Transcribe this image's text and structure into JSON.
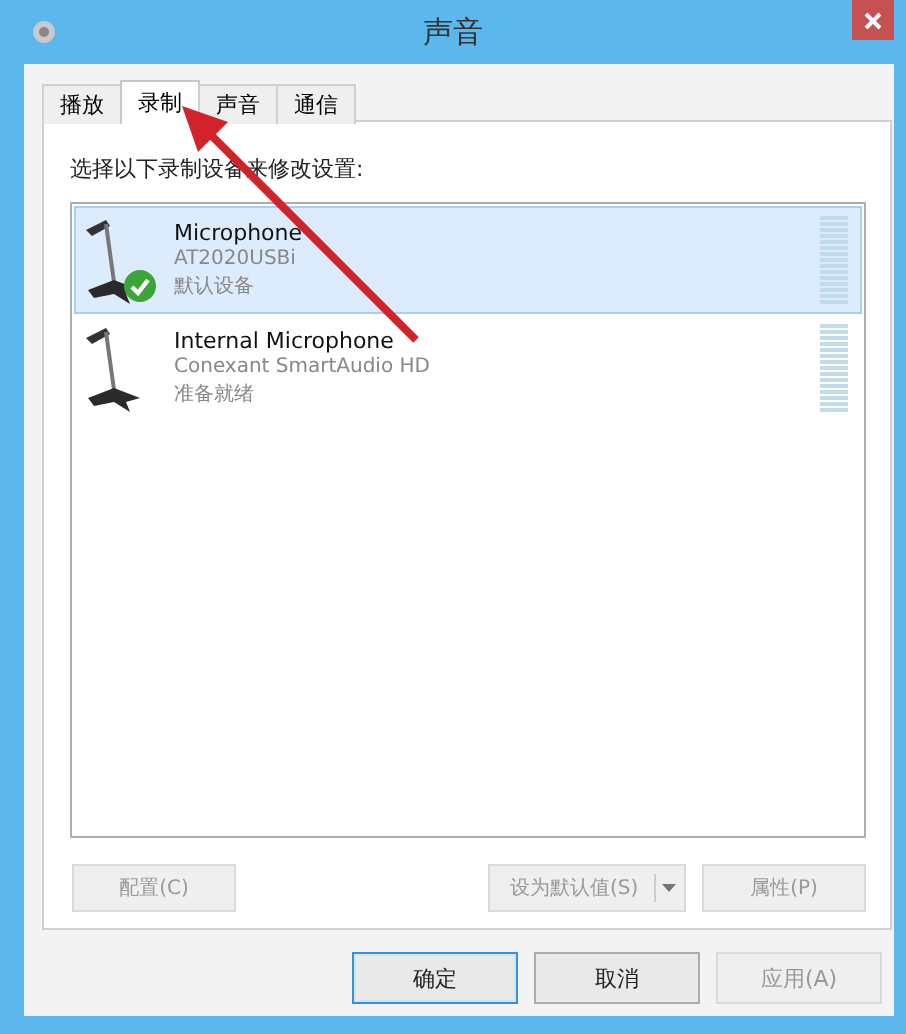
{
  "window": {
    "title": "声音"
  },
  "tabs": [
    {
      "label": "播放",
      "selected": false
    },
    {
      "label": "录制",
      "selected": true
    },
    {
      "label": "声音",
      "selected": false
    },
    {
      "label": "通信",
      "selected": false
    }
  ],
  "instruction": "选择以下录制设备来修改设置:",
  "devices": [
    {
      "name": "Microphone",
      "description": "AT2020USBi",
      "status": "默认设备",
      "selected": true,
      "default": true
    },
    {
      "name": "Internal Microphone",
      "description": "Conexant SmartAudio HD",
      "status": "准备就绪",
      "selected": false,
      "default": false
    }
  ],
  "panel_buttons": {
    "configure": {
      "label": "配置(C)",
      "disabled": true
    },
    "set_default": {
      "label": "设为默认值(S)",
      "disabled": true
    },
    "properties": {
      "label": "属性(P)",
      "disabled": true
    }
  },
  "dialog_buttons": [
    {
      "label": "确定",
      "disabled": false,
      "focused": true
    },
    {
      "label": "取消",
      "disabled": false,
      "focused": false
    },
    {
      "label": "应用(A)",
      "disabled": true,
      "focused": false
    }
  ]
}
